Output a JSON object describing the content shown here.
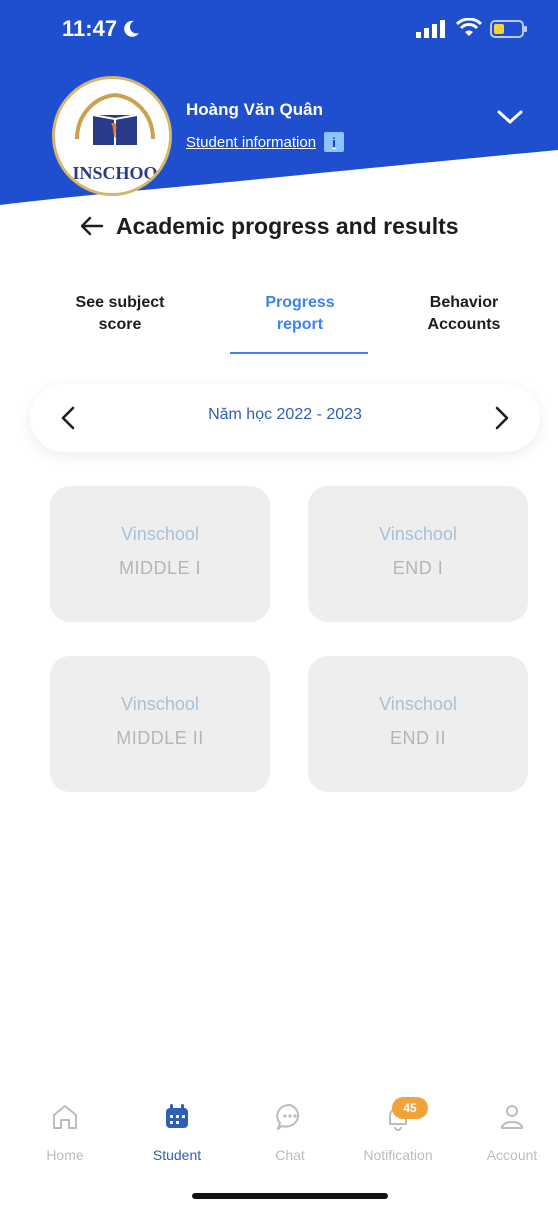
{
  "status_bar": {
    "time": "11:47"
  },
  "header": {
    "student_name": "Hoàng Văn Quân",
    "student_info_link": "Student information",
    "info_icon_glyph": "i",
    "logo_text": "INSCHOO",
    "brand_color": "#1f4fcf"
  },
  "page": {
    "title": "Academic progress and results"
  },
  "tabs": [
    {
      "label_line1": "See subject",
      "label_line2": "score",
      "active": false
    },
    {
      "label_line1": "Progress",
      "label_line2": "report",
      "active": true
    },
    {
      "label_line1": "Behavior",
      "label_line2": "Accounts",
      "active": false
    }
  ],
  "year_selector": {
    "label": "Năm học 2022 - 2023"
  },
  "cards": [
    {
      "school": "Vinschool",
      "term": "MIDDLE I"
    },
    {
      "school": "Vinschool",
      "term": "END I"
    },
    {
      "school": "Vinschool",
      "term": "MIDDLE II"
    },
    {
      "school": "Vinschool",
      "term": "END II"
    }
  ],
  "bottom_nav": {
    "items": [
      {
        "label": "Home",
        "icon": "home-icon",
        "active": false
      },
      {
        "label": "Student",
        "icon": "calendar-icon",
        "active": true
      },
      {
        "label": "Chat",
        "icon": "chat-icon",
        "active": false
      },
      {
        "label": "Notification",
        "icon": "bell-icon",
        "active": false
      },
      {
        "label": "Account",
        "icon": "user-icon",
        "active": false
      }
    ],
    "notification_badge": "45"
  }
}
